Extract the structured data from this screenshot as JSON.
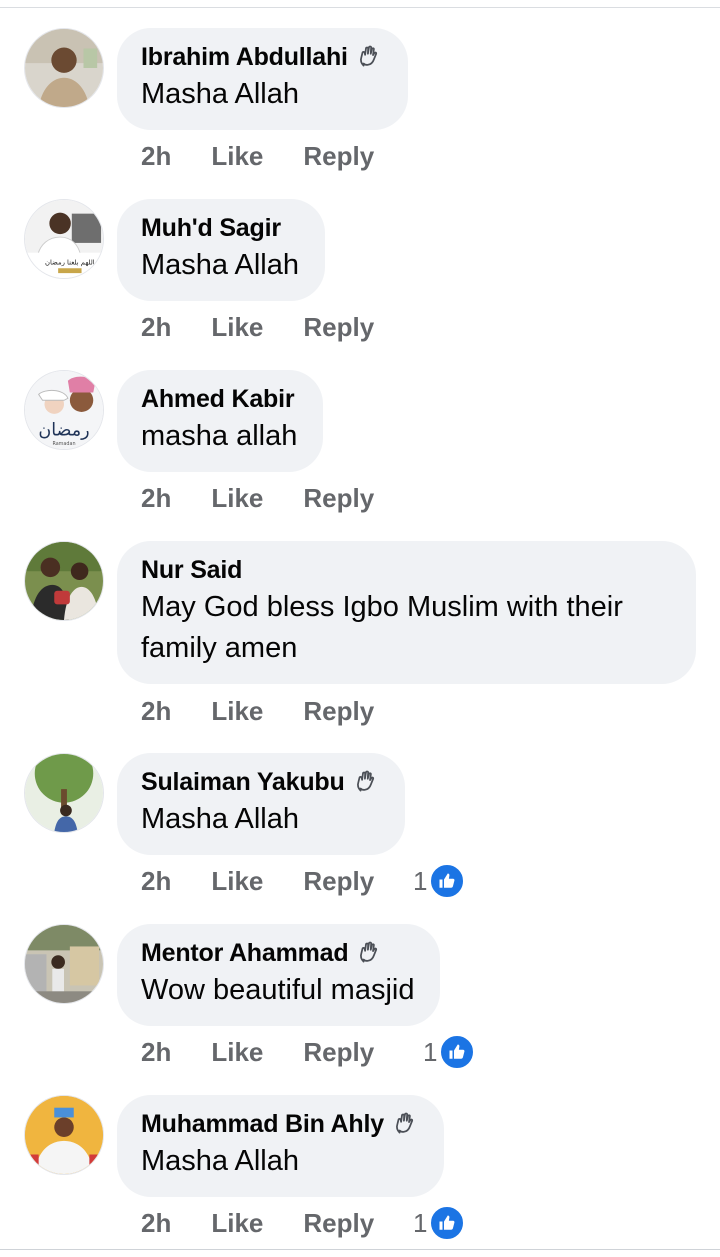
{
  "comments": [
    {
      "name": "Ibrahim Abdullahi",
      "text": "Masha Allah",
      "time": "2h",
      "like_label": "Like",
      "reply_label": "Reply",
      "has_wave_badge": true,
      "reactions": null
    },
    {
      "name": "Muh'd Sagir",
      "text": "Masha Allah",
      "time": "2h",
      "like_label": "Like",
      "reply_label": "Reply",
      "has_wave_badge": false,
      "reactions": null
    },
    {
      "name": "Ahmed Kabir",
      "text": "masha allah",
      "time": "2h",
      "like_label": "Like",
      "reply_label": "Reply",
      "has_wave_badge": false,
      "reactions": null
    },
    {
      "name": "Nur Said",
      "text": "May God bless Igbo Muslim with their family amen",
      "time": "2h",
      "like_label": "Like",
      "reply_label": "Reply",
      "has_wave_badge": false,
      "reactions": null
    },
    {
      "name": "Sulaiman Yakubu",
      "text": "Masha Allah",
      "time": "2h",
      "like_label": "Like",
      "reply_label": "Reply",
      "has_wave_badge": true,
      "reactions": "1"
    },
    {
      "name": "Mentor Ahammad",
      "text": "Wow beautiful masjid",
      "time": "2h",
      "like_label": "Like",
      "reply_label": "Reply",
      "has_wave_badge": true,
      "reactions": "1"
    },
    {
      "name": "Muhammad Bin Ahly",
      "text": "Masha Allah",
      "time": "2h",
      "like_label": "Like",
      "reply_label": "Reply",
      "has_wave_badge": true,
      "reactions": "1"
    }
  ],
  "avatar_ring_text": {
    "ahmed_kabir": "رمضان",
    "ahmed_kabir_sub": "Ramadan",
    "muhd_sagir": "اللهم بلغنا رمضان"
  },
  "colors": {
    "bubble": "#f0f2f5",
    "meta_text": "#65676b",
    "like_badge": "#1b74e4"
  },
  "icons": {
    "wave": "waving-hand-icon",
    "like": "thumbs-up-icon"
  }
}
